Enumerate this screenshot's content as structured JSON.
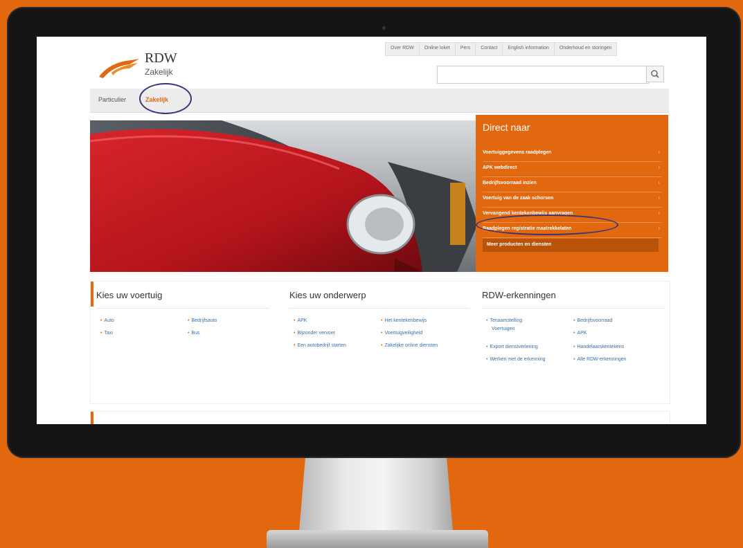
{
  "site": {
    "brand": "RDW",
    "brand_sub": "Zakelijk"
  },
  "util_nav": [
    "Over RDW",
    "Online loket",
    "Pers",
    "Contact",
    "English information",
    "Onderhoud en storingen"
  ],
  "search": {
    "placeholder": ""
  },
  "main_nav": {
    "particulier": "Particulier",
    "zakelijk": "Zakelijk"
  },
  "direct": {
    "title": "Direct naar",
    "items": [
      "Voertuiggegevens raadplegen",
      "APK webdirect",
      "Bedrijfsvoorraad inzien",
      "Voertuig van de zaak schorsen",
      "Vervangend kentekenbewijs aanvragen",
      "Raadplegen registratie maatrekkelaten"
    ],
    "more": "Meer producten en diensten"
  },
  "columns": {
    "voertuig": {
      "title": "Kies uw voertuig",
      "links": [
        "Auto",
        "Bedrijfsauto",
        "Taxi",
        "Bus"
      ]
    },
    "onderwerp": {
      "title": "Kies uw onderwerp",
      "links": [
        "APK",
        "Het kentekenbewijs",
        "Bijzonder vervoer",
        "Voertuigveiligheid",
        "Een autobedrijf starten",
        "Zakelijke online diensten"
      ]
    },
    "erkenningen": {
      "title": "RDW-erkenningen",
      "links": [
        "Tenaamstelling",
        "Voertuigen",
        "Bedrijfsvoorraad",
        "APK",
        "Export dienstverlening",
        "Handelaarskentekens",
        "Werken met de erkenning",
        "Alle RDW-erkenningen"
      ]
    }
  },
  "colors": {
    "accent": "#e2680f",
    "highlight_circle": "#3a3577",
    "link": "#3a6fb0"
  }
}
